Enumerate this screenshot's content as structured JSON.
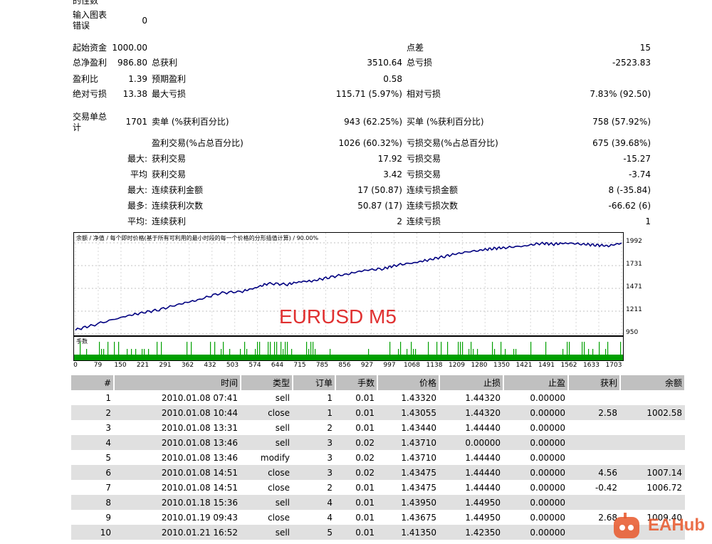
{
  "top_partial": {
    "text": "的性数"
  },
  "input_error": {
    "label": "输入图表错误",
    "line1": "输入图表",
    "line2": "错误",
    "value": "0"
  },
  "stats": {
    "initial_deposit": {
      "label": "起始资金",
      "value": "1000.00"
    },
    "spread": {
      "label": "点差",
      "value": "15"
    },
    "net_profit": {
      "label": "总净盈利",
      "value": "986.80"
    },
    "gross_profit": {
      "label": "总获利",
      "value": "3510.64"
    },
    "gross_loss": {
      "label": "总亏损",
      "value": "-2523.83"
    },
    "profit_factor": {
      "label": "盈利比",
      "value": "1.39"
    },
    "expected_payoff": {
      "label": "预期盈利",
      "value": "0.58"
    },
    "absolute_drawdown": {
      "label": "绝对亏损",
      "value": "13.38"
    },
    "max_drawdown": {
      "label": "最大亏损",
      "value": "115.71 (5.97%)"
    },
    "relative_drawdown": {
      "label": "相对亏损",
      "value": "7.83% (92.50)"
    },
    "total_trades": {
      "label": "交易单总计",
      "line1": "交易单总",
      "line2": "计",
      "value": "1701"
    },
    "short_positions": {
      "label": "卖单 (%获利百分比)",
      "value": "943 (62.25%)"
    },
    "long_positions": {
      "label": "买单 (%获利百分比)",
      "value": "758 (57.92%)"
    },
    "profit_trades": {
      "label": "盈利交易(%占总百分比)",
      "value": "1026 (60.32%)"
    },
    "loss_trades": {
      "label": "亏损交易(%占总百分比)",
      "value": "675 (39.68%)"
    },
    "largest_label": "最大:",
    "largest_profit": {
      "label": "获利交易",
      "value": "17.92"
    },
    "largest_loss": {
      "label": "亏损交易",
      "value": "-15.27"
    },
    "average_label": "平均",
    "average_profit": {
      "label": "获利交易",
      "value": "3.42"
    },
    "average_loss": {
      "label": "亏损交易",
      "value": "-3.74"
    },
    "max_label": "最大:",
    "max_consec_wins_money": {
      "label": "连续获利金额",
      "value": "17 (50.87)"
    },
    "max_consec_losses_money": {
      "label": "连续亏损金额",
      "value": "8 (-35.84)"
    },
    "most_label": "最多:",
    "max_consec_profit_count": {
      "label": "连续获利次数",
      "value": "50.87 (17)"
    },
    "max_consec_loss_count": {
      "label": "连续亏损次数",
      "value": "-66.62 (6)"
    },
    "avg_label": "平均:",
    "avg_consec_wins": {
      "label": "连续获利",
      "value": "2"
    },
    "avg_consec_losses": {
      "label": "连续亏损",
      "value": "1"
    }
  },
  "chart": {
    "legend": "余额 / 净值 / 每个即时价格(基于所有可利用的最小时段的每一个价格的分形插值计算) / 90.00%",
    "overlay_title": "EURUSD M5",
    "volume_label": "手数",
    "line_color": "#000080",
    "volume_color": "#00a000",
    "title_color": "#e03030"
  },
  "chart_data": {
    "type": "line",
    "title": "EURUSD M5",
    "ylabel": "",
    "xlabel": "",
    "y_ticks": [
      "950",
      "1211",
      "1471",
      "1731",
      "1992"
    ],
    "x_ticks": [
      "0",
      "79",
      "150",
      "221",
      "291",
      "362",
      "432",
      "503",
      "574",
      "644",
      "715",
      "785",
      "856",
      "927",
      "997",
      "1068",
      "1138",
      "1209",
      "1280",
      "1350",
      "1421",
      "1491",
      "1562",
      "1633",
      "1703"
    ],
    "ylim": [
      950,
      1992
    ],
    "xlim": [
      0,
      1701
    ],
    "grid": true,
    "series": [
      {
        "name": "余额",
        "x": [
          0,
          60,
          150,
          200,
          260,
          330,
          380,
          450,
          520,
          560,
          600,
          660,
          700,
          740,
          790,
          850,
          900,
          960,
          1000,
          1060,
          1100,
          1150,
          1200,
          1260,
          1300,
          1340,
          1400,
          1450,
          1490,
          1530,
          1580,
          1620,
          1660,
          1701
        ],
        "y": [
          1000,
          1060,
          1150,
          1190,
          1230,
          1300,
          1340,
          1420,
          1440,
          1480,
          1530,
          1520,
          1550,
          1560,
          1600,
          1640,
          1680,
          1700,
          1740,
          1770,
          1800,
          1840,
          1880,
          1910,
          1930,
          1940,
          1960,
          1990,
          1980,
          1992,
          1980,
          1970,
          1960,
          1992
        ]
      }
    ]
  },
  "table": {
    "headers": [
      "#",
      "时间",
      "类型",
      "订单",
      "手数",
      "价格",
      "止损",
      "止盈",
      "获利",
      "余额"
    ],
    "rows": [
      [
        "1",
        "2010.01.08 07:41",
        "sell",
        "1",
        "0.01",
        "1.43320",
        "1.44320",
        "0.00000",
        "",
        ""
      ],
      [
        "2",
        "2010.01.08 10:44",
        "close",
        "1",
        "0.01",
        "1.43055",
        "1.44320",
        "0.00000",
        "2.58",
        "1002.58"
      ],
      [
        "3",
        "2010.01.08 13:31",
        "sell",
        "2",
        "0.01",
        "1.43440",
        "1.44440",
        "0.00000",
        "",
        ""
      ],
      [
        "4",
        "2010.01.08 13:46",
        "sell",
        "3",
        "0.02",
        "1.43710",
        "0.00000",
        "0.00000",
        "",
        ""
      ],
      [
        "5",
        "2010.01.08 13:46",
        "modify",
        "3",
        "0.02",
        "1.43710",
        "1.44440",
        "0.00000",
        "",
        ""
      ],
      [
        "6",
        "2010.01.08 14:51",
        "close",
        "3",
        "0.02",
        "1.43475",
        "1.44440",
        "0.00000",
        "4.56",
        "1007.14"
      ],
      [
        "7",
        "2010.01.08 14:51",
        "close",
        "2",
        "0.01",
        "1.43475",
        "1.44440",
        "0.00000",
        "-0.42",
        "1006.72"
      ],
      [
        "8",
        "2010.01.18 15:36",
        "sell",
        "4",
        "0.01",
        "1.43950",
        "1.44950",
        "0.00000",
        "",
        ""
      ],
      [
        "9",
        "2010.01.19 09:43",
        "close",
        "4",
        "0.01",
        "1.43675",
        "1.44950",
        "0.00000",
        "2.68",
        "1009.40"
      ],
      [
        "10",
        "2010.01.21 16:52",
        "sell",
        "5",
        "0.01",
        "1.41350",
        "1.42350",
        "0.00000",
        "",
        ""
      ]
    ]
  },
  "watermark": {
    "text": "EAHub",
    "color": "#e8572a"
  }
}
